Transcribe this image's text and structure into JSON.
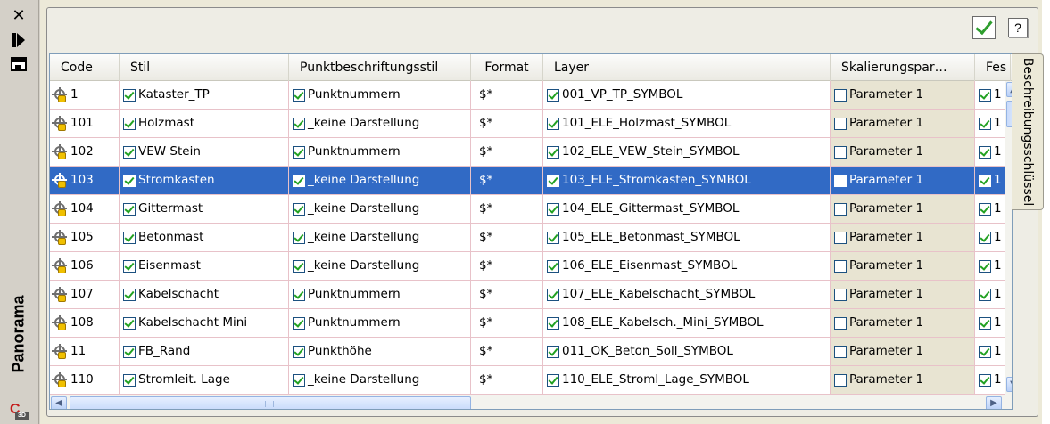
{
  "palette": {
    "title": "Panorama",
    "close_glyph": "✕",
    "logo_letter": "C",
    "logo_badge": "3D"
  },
  "toolbar": {
    "ok_icon": "checkmark-icon",
    "help_label": "?"
  },
  "side_tab": {
    "label": "Beschreibungsschlüssel"
  },
  "columns": [
    "Code",
    "Stil",
    "Punktbeschriftungsstil",
    "Format",
    "Layer",
    "Skalierungspar…",
    "Fes"
  ],
  "rows": [
    {
      "code": "1",
      "stil": "Kataster_TP",
      "punkt": "Punktnummern",
      "format": "$*",
      "layer": "001_VP_TP_SYMBOL",
      "skal": "Parameter 1",
      "fes": "1",
      "selected": false
    },
    {
      "code": "101",
      "stil": "Holzmast",
      "punkt": "_keine Darstellung",
      "format": "$*",
      "layer": "101_ELE_Holzmast_SYMBOL",
      "skal": "Parameter 1",
      "fes": "1",
      "selected": false
    },
    {
      "code": "102",
      "stil": "VEW Stein",
      "punkt": "Punktnummern",
      "format": "$*",
      "layer": "102_ELE_VEW_Stein_SYMBOL",
      "skal": "Parameter 1",
      "fes": "1",
      "selected": false
    },
    {
      "code": "103",
      "stil": "Stromkasten",
      "punkt": "_keine Darstellung",
      "format": "$*",
      "layer": "103_ELE_Stromkasten_SYMBOL",
      "skal": "Parameter 1",
      "fes": "1",
      "selected": true
    },
    {
      "code": "104",
      "stil": "Gittermast",
      "punkt": "_keine Darstellung",
      "format": "$*",
      "layer": "104_ELE_Gittermast_SYMBOL",
      "skal": "Parameter 1",
      "fes": "1",
      "selected": false
    },
    {
      "code": "105",
      "stil": "Betonmast",
      "punkt": "_keine Darstellung",
      "format": "$*",
      "layer": "105_ELE_Betonmast_SYMBOL",
      "skal": "Parameter 1",
      "fes": "1",
      "selected": false
    },
    {
      "code": "106",
      "stil": "Eisenmast",
      "punkt": "_keine Darstellung",
      "format": "$*",
      "layer": "106_ELE_Eisenmast_SYMBOL",
      "skal": "Parameter 1",
      "fes": "1",
      "selected": false
    },
    {
      "code": "107",
      "stil": "Kabelschacht",
      "punkt": "Punktnummern",
      "format": "$*",
      "layer": "107_ELE_Kabelschacht_SYMBOL",
      "skal": "Parameter 1",
      "fes": "1",
      "selected": false
    },
    {
      "code": "108",
      "stil": "Kabelschacht Mini",
      "punkt": "Punktnummern",
      "format": "$*",
      "layer": "108_ELE_Kabelsch._Mini_SYMBOL",
      "skal": "Parameter 1",
      "fes": "1",
      "selected": false
    },
    {
      "code": "11",
      "stil": "FB_Rand",
      "punkt": "Punkthöhe",
      "format": "$*",
      "layer": "011_OK_Beton_Soll_SYMBOL",
      "skal": "Parameter 1",
      "fes": "1",
      "selected": false
    },
    {
      "code": "110",
      "stil": "Stromleit. Lage",
      "punkt": "_keine Darstellung",
      "format": "$*",
      "layer": "110_ELE_Stroml_Lage_SYMBOL",
      "skal": "Parameter 1",
      "fes": "1",
      "selected": false
    }
  ],
  "colors": {
    "selection": "#316ac5",
    "check": "#21a121",
    "grid_line": "#e8c2c9"
  }
}
